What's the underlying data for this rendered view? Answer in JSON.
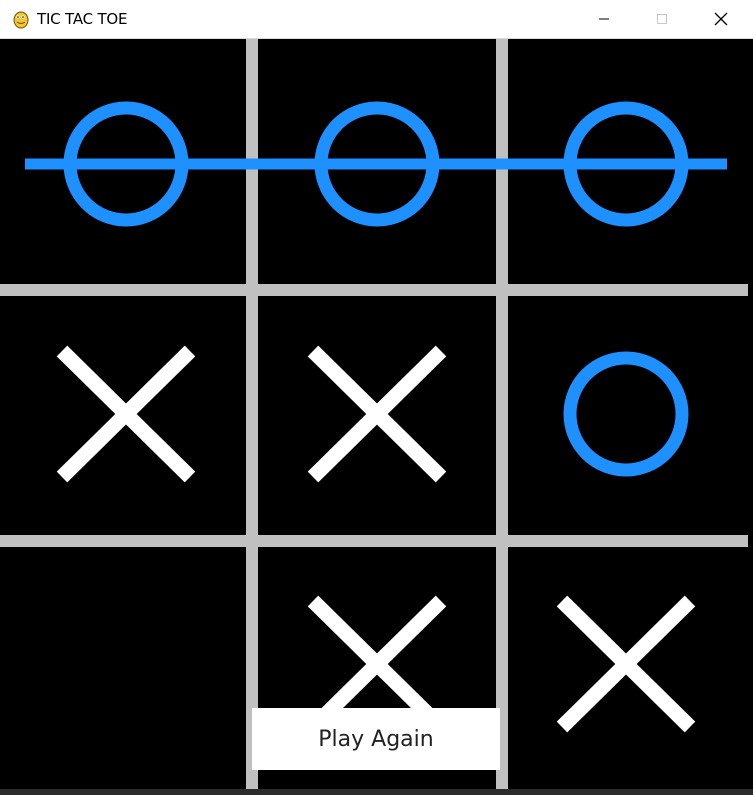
{
  "window": {
    "title": "TIC TAC TOE",
    "icon": "pygame-snake-icon",
    "controls": [
      "minimize-icon",
      "maximize-icon",
      "close-icon"
    ]
  },
  "colors": {
    "background": "#000000",
    "grid": "#c0c0c0",
    "o_mark": "#1e90ff",
    "x_mark": "#ffffff",
    "win_line": "#1e90ff"
  },
  "board": {
    "size": 3,
    "cells": [
      [
        "O",
        "O",
        "O"
      ],
      [
        "X",
        "X",
        "O"
      ],
      [
        "",
        "X",
        "X"
      ]
    ],
    "winner": "O",
    "winning_line": {
      "type": "row",
      "index": 0
    }
  },
  "play_again": {
    "label": "Play Again"
  }
}
